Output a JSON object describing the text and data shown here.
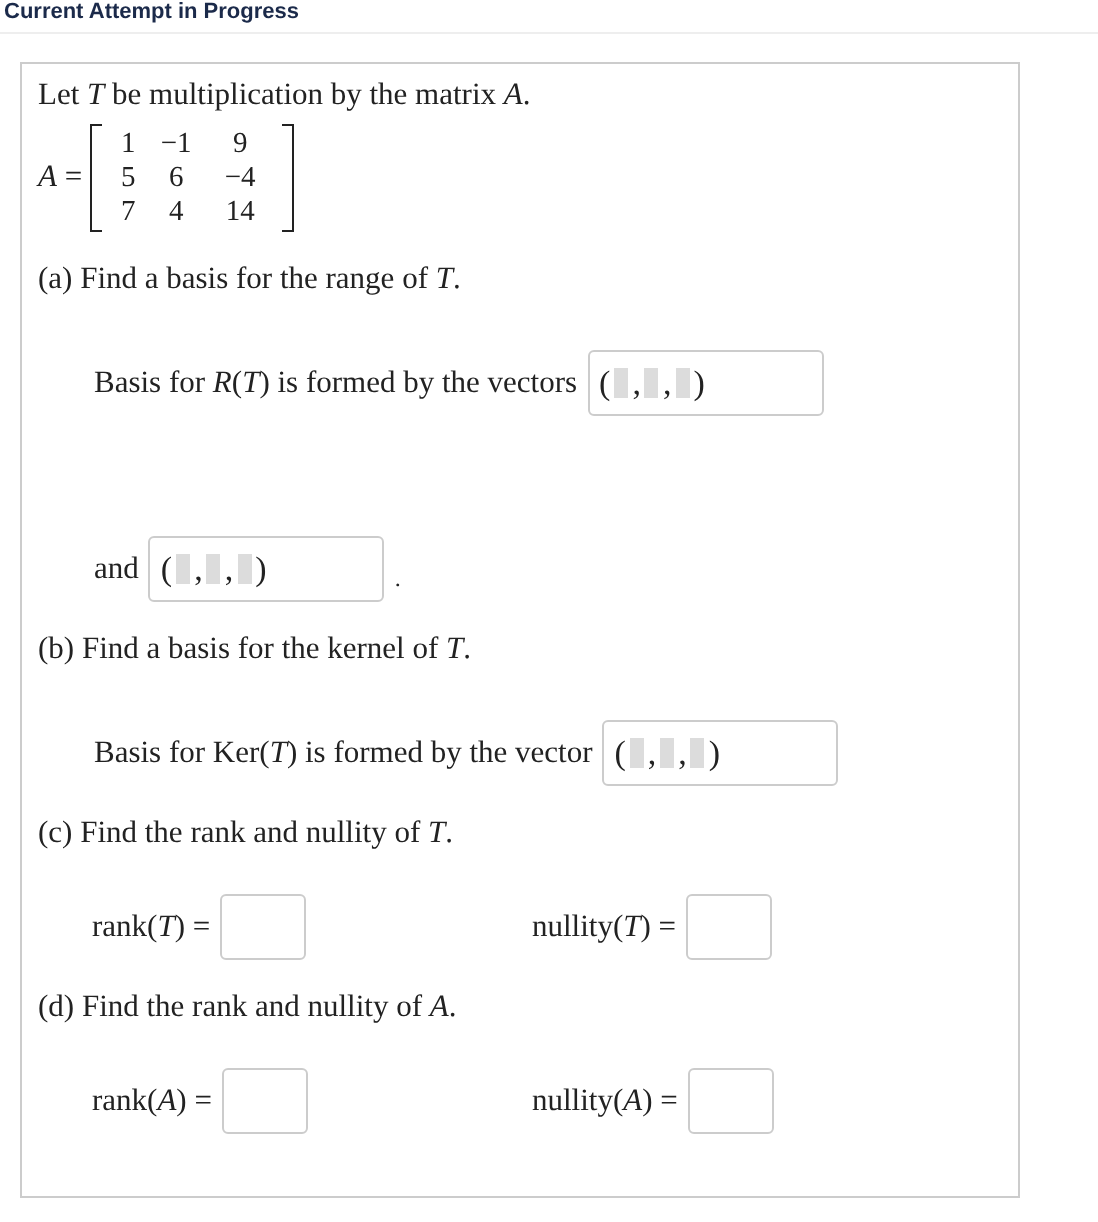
{
  "header": {
    "title": "Current Attempt in Progress"
  },
  "intro": "Let *T* be multiplication by the matrix *A*.",
  "matrix": {
    "label": "*A* =",
    "rows": [
      [
        "1",
        "−1",
        "9"
      ],
      [
        "5",
        "6",
        "−4"
      ],
      [
        "7",
        "4",
        "14"
      ]
    ]
  },
  "parts": [
    {
      "kind": "heading",
      "text": "(a) Find a basis for the range of *T*."
    },
    {
      "kind": "vector_line",
      "before": "Basis for *R*(*T*) is formed by the vectors",
      "field": {
        "text_parts": [
          "(",
          ",",
          ",",
          ")"
        ]
      }
    },
    {
      "kind": "vector_line",
      "before": "and",
      "field": {
        "text_parts": [
          "(",
          ",",
          ",",
          ")"
        ]
      },
      "after": "."
    },
    {
      "kind": "heading",
      "text": "(b) Find a basis for the kernel of *T*."
    },
    {
      "kind": "vector_line",
      "before": "Basis for Ker(*T*) is formed by the vector",
      "field": {
        "text_parts": [
          "(",
          ",",
          ",",
          ")"
        ]
      }
    },
    {
      "kind": "heading",
      "text": "(c) Find the rank and nullity of *T*."
    },
    {
      "kind": "pair_line",
      "items": [
        {
          "label": "rank(*T*) ="
        },
        {
          "label": "nullity(*T*) ="
        }
      ]
    },
    {
      "kind": "heading",
      "text": "(d) Find the rank and nullity of *A*."
    },
    {
      "kind": "pair_line",
      "items": [
        {
          "label": "rank(*A*) ="
        },
        {
          "label": "nullity(*A*) ="
        }
      ]
    }
  ]
}
